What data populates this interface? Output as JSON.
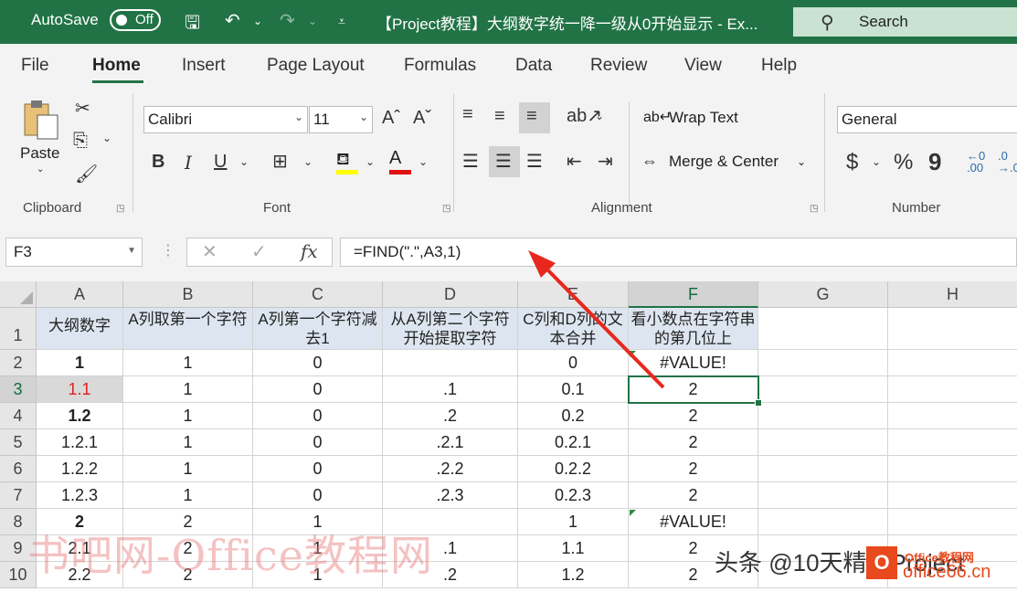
{
  "titlebar": {
    "autosave_label": "AutoSave",
    "autosave_state": "Off",
    "title": "【Project教程】大纲数字统一降一级从0开始显示 - Ex...",
    "search_label": "Search"
  },
  "menu": [
    "File",
    "Home",
    "Insert",
    "Page Layout",
    "Formulas",
    "Data",
    "Review",
    "View",
    "Help"
  ],
  "ribbon": {
    "clipboard": {
      "paste": "Paste",
      "label": "Clipboard"
    },
    "font": {
      "name": "Calibri",
      "size": "11",
      "label": "Font",
      "bold": "B",
      "italic": "I",
      "underline": "U"
    },
    "alignment": {
      "wrap": "Wrap Text",
      "merge": "Merge & Center",
      "label": "Alignment"
    },
    "number": {
      "format": "General",
      "label": "Number",
      "currency": "$",
      "percent": "%",
      "comma": "9"
    }
  },
  "formula_bar": {
    "name_box": "F3",
    "formula": "=FIND(\".\",A3,1)"
  },
  "columns": [
    "A",
    "B",
    "C",
    "D",
    "E",
    "F",
    "G",
    "H"
  ],
  "row_numbers": [
    "1",
    "2",
    "3",
    "4",
    "5",
    "6",
    "7",
    "8",
    "9",
    "10"
  ],
  "rows": [
    [
      "大纲数字",
      "A列取第一个字符",
      "A列第一个字符减去1",
      "从A列第二个字符开始提取字符",
      "C列和D列的文本合并",
      "看小数点在字符串的第几位上",
      "",
      ""
    ],
    [
      "1",
      "1",
      "0",
      "",
      "0",
      "#VALUE!",
      "",
      ""
    ],
    [
      "1.1",
      "1",
      "0",
      ".1",
      "0.1",
      "2",
      "",
      ""
    ],
    [
      "1.2",
      "1",
      "0",
      ".2",
      "0.2",
      "2",
      "",
      ""
    ],
    [
      "1.2.1",
      "1",
      "0",
      ".2.1",
      "0.2.1",
      "2",
      "",
      ""
    ],
    [
      "1.2.2",
      "1",
      "0",
      ".2.2",
      "0.2.2",
      "2",
      "",
      ""
    ],
    [
      "1.2.3",
      "1",
      "0",
      ".2.3",
      "0.2.3",
      "2",
      "",
      ""
    ],
    [
      "2",
      "2",
      "1",
      "",
      "1",
      "#VALUE!",
      "",
      ""
    ],
    [
      "2.1",
      "2",
      "1",
      ".1",
      "1.1",
      "2",
      "",
      ""
    ],
    [
      "2.2",
      "2",
      "1",
      ".2",
      "1.2",
      "2",
      "",
      ""
    ]
  ],
  "watermarks": {
    "left": "书吧网-Office教程网",
    "right": "头条 @10天精通Project",
    "logo": "O",
    "site_small": "Office教程网",
    "site": "office66.cn"
  },
  "colors": {
    "excel_green": "#217346",
    "red_text": "#e02020",
    "arrow": "#e8281e"
  }
}
